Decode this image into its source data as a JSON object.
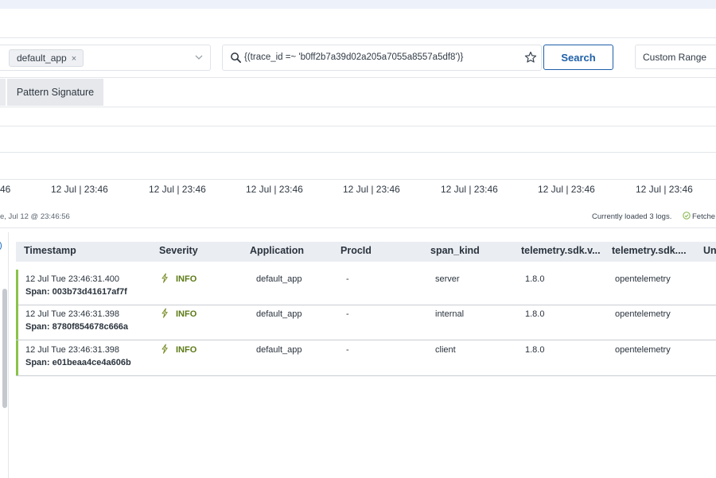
{
  "filter": {
    "app_chip": "default_app",
    "chip_remove": "×",
    "query": "{(trace_id =~ 'b0ff2b7a39d02a205a7055a8557a5df8')}",
    "search_label": "Search",
    "range_label": "Custom Range"
  },
  "tabs": [
    "Pattern Signature"
  ],
  "timeline": {
    "ticks": [
      "46",
      "12 Jul | 23:46",
      "12 Jul | 23:46",
      "12 Jul | 23:46",
      "12 Jul | 23:46",
      "12 Jul | 23:46",
      "12 Jul | 23:46",
      "12 Jul | 23:46"
    ],
    "range_text": "e, Jul 12 @ 23:46:56",
    "loaded_text": "Currently loaded 3 logs.",
    "fetch_text": "Fetche"
  },
  "table": {
    "columns": [
      "Timestamp",
      "Severity",
      "Application",
      "ProcId",
      "span_kind",
      "telemetry.sdk.v...",
      "telemetry.sdk....",
      "Un"
    ],
    "rows": [
      {
        "timestamp": "12 Jul  Tue 23:46:31.400",
        "span": "Span:  003b73d41617af7f",
        "severity": "INFO",
        "application": "default_app",
        "procid": "-",
        "span_kind": "server",
        "sdk_version": "1.8.0",
        "sdk_name": "opentelemetry"
      },
      {
        "timestamp": "12 Jul  Tue 23:46:31.398",
        "span": "Span:  8780f854678c666a",
        "severity": "INFO",
        "application": "default_app",
        "procid": "-",
        "span_kind": "internal",
        "sdk_version": "1.8.0",
        "sdk_name": "opentelemetry"
      },
      {
        "timestamp": "12 Jul  Tue 23:46:31.398",
        "span": "Span:  e01beaa4ce4a606b",
        "severity": "INFO",
        "application": "default_app",
        "procid": "-",
        "span_kind": "client",
        "sdk_version": "1.8.0",
        "sdk_name": "opentelemetry"
      }
    ]
  },
  "colors": {
    "accent": "#1e5fa8",
    "severity_info": "#5c7a16",
    "row_marker": "#8bc34a"
  },
  "icons": [
    "search-icon",
    "star-icon",
    "chevron-down-icon",
    "lightning-icon",
    "check-circle-icon"
  ]
}
